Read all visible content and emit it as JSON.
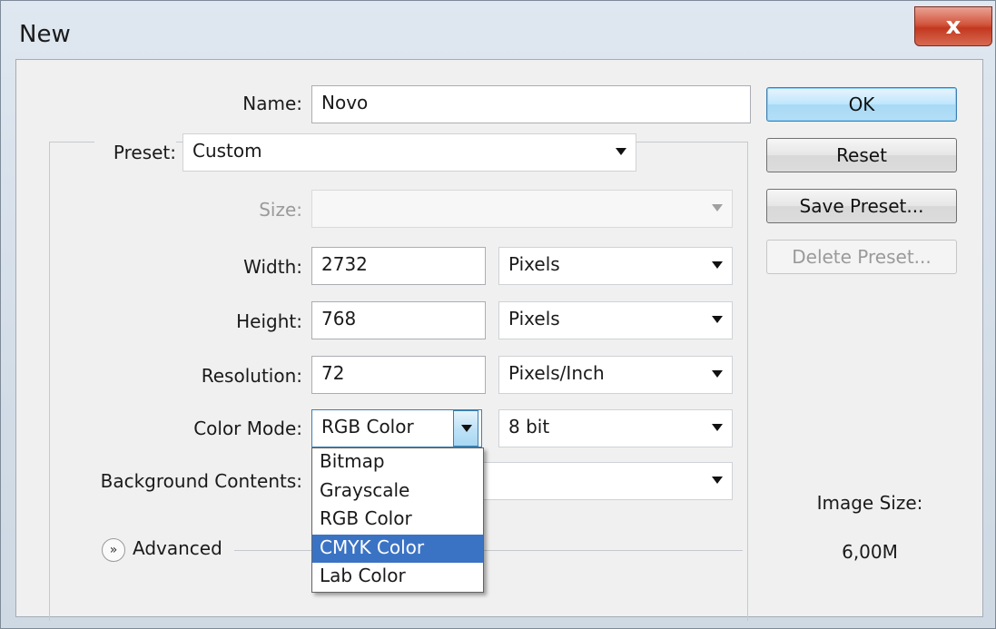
{
  "window": {
    "title": "New",
    "close_label": "x"
  },
  "form": {
    "name": {
      "label": "Name:",
      "value": "Novo"
    },
    "preset": {
      "label": "Preset:",
      "value": "Custom"
    },
    "size": {
      "label": "Size:",
      "value": ""
    },
    "width": {
      "label": "Width:",
      "value": "2732",
      "unit": "Pixels"
    },
    "height": {
      "label": "Height:",
      "value": "768",
      "unit": "Pixels"
    },
    "resolution": {
      "label": "Resolution:",
      "value": "72",
      "unit": "Pixels/Inch"
    },
    "color_mode": {
      "label": "Color Mode:",
      "value": "RGB Color",
      "bit_depth": "8 bit",
      "options": [
        "Bitmap",
        "Grayscale",
        "RGB Color",
        "CMYK Color",
        "Lab Color"
      ],
      "highlighted": "CMYK Color"
    },
    "background": {
      "label": "Background Contents:",
      "value": ""
    },
    "advanced": {
      "label": "Advanced"
    }
  },
  "buttons": {
    "ok": "OK",
    "reset": "Reset",
    "save_preset": "Save Preset...",
    "delete_preset": "Delete Preset..."
  },
  "image_size": {
    "label": "Image Size:",
    "value": "6,00M"
  }
}
